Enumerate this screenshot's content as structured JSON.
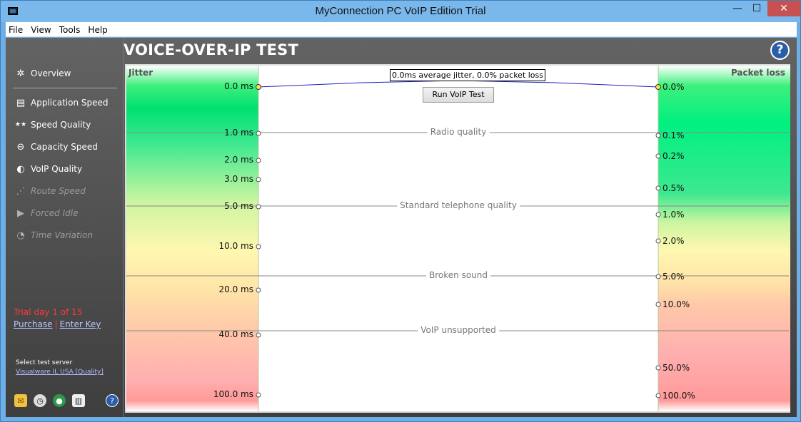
{
  "window": {
    "title": "MyConnection PC VoIP Edition Trial",
    "controls": {
      "minimize": "—",
      "maximize": "☐",
      "close": "✕"
    }
  },
  "menu": [
    "File",
    "View",
    "Tools",
    "Help"
  ],
  "heading": "VOICE-OVER-IP TEST",
  "help_label": "?",
  "sidebar": {
    "items": [
      {
        "label": "Overview",
        "icon": "overview-icon",
        "enabled": true
      },
      {
        "label": "Application Speed",
        "icon": "application-speed-icon",
        "enabled": true
      },
      {
        "label": "Speed Quality",
        "icon": "speed-quality-icon",
        "enabled": true
      },
      {
        "label": "Capacity Speed",
        "icon": "capacity-speed-icon",
        "enabled": true
      },
      {
        "label": "VoIP Quality",
        "icon": "voip-quality-icon",
        "enabled": true
      },
      {
        "label": "Route Speed",
        "icon": "route-speed-icon",
        "enabled": false
      },
      {
        "label": "Forced Idle",
        "icon": "forced-idle-icon",
        "enabled": false
      },
      {
        "label": "Time Variation",
        "icon": "time-variation-icon",
        "enabled": false
      }
    ],
    "trial_text": "Trial day 1 of 15",
    "purchase_label": "Purchase",
    "separator": "|",
    "enter_key_label": "Enter Key",
    "select_server_label": "Select test server",
    "server_link": "Visualware IL USA [Quality]",
    "bottom_icons": [
      "email-icon",
      "clock-icon",
      "globe-icon",
      "report-icon",
      "help-icon"
    ]
  },
  "chart": {
    "jitter_title": "Jitter",
    "loss_title": "Packet loss",
    "summary": "0.0ms average jitter, 0.0% packet loss",
    "run_button": "Run VoIP Test",
    "jitter_ticks": [
      "0.0 ms",
      "1.0 ms",
      "2.0 ms",
      "3.0 ms",
      "5.0 ms",
      "10.0 ms",
      "20.0 ms",
      "40.0 ms",
      "100.0 ms"
    ],
    "loss_ticks": [
      "0.0%",
      "0.1%",
      "0.2%",
      "0.5%",
      "1.0%",
      "2.0%",
      "5.0%",
      "10.0%",
      "50.0%",
      "100.0%"
    ],
    "zones": [
      "Radio quality",
      "Standard telephone quality",
      "Broken sound",
      "VoIP unsupported"
    ],
    "result": {
      "jitter_ms": 0.0,
      "packet_loss_pct": 0.0
    },
    "colors": {
      "good": "#00e070",
      "fair": "#fff7b0",
      "poor": "#ff9a9a",
      "line": "#2020c0",
      "point": "#f5e84a"
    }
  }
}
